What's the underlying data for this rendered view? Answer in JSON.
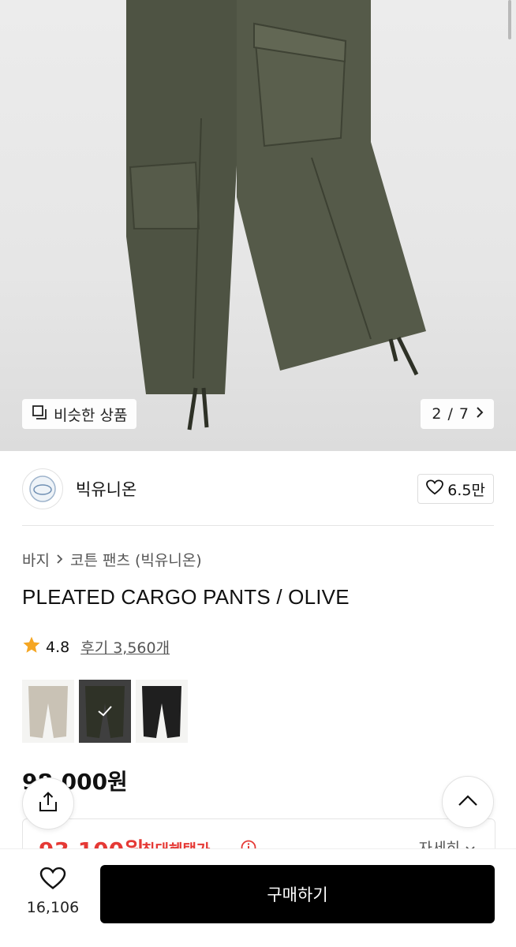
{
  "gallery": {
    "similar_label": "비슷한 상품",
    "page_current": "2",
    "page_separator": "/",
    "page_total": "7"
  },
  "brand": {
    "name": "빅유니온",
    "likes": "6.5만"
  },
  "breadcrumb": {
    "category": "바지",
    "sub_category": "코튼 팬츠 (빅유니온)"
  },
  "product": {
    "title": "PLEATED CARGO PANTS / OLIVE",
    "rating": "4.8",
    "reviews": "후기 3,560개",
    "price": "98,000원",
    "color_options": [
      {
        "color": "beige",
        "hex": "#c9c2b5",
        "selected": false
      },
      {
        "color": "olive",
        "hex": "#4e5343",
        "selected": true
      },
      {
        "color": "black",
        "hex": "#1f1f1f",
        "selected": false
      }
    ]
  },
  "benefit": {
    "price": "93,100원",
    "label": "최대혜택가",
    "detail": "자세히"
  },
  "bottom": {
    "wish_count": "16,106",
    "buy_label": "구매하기"
  },
  "colors": {
    "accent_red": "#e53935",
    "buy_button": "#000000",
    "product_olive": "#4e5343"
  },
  "icons": [
    "similar-icon",
    "chevron-right-icon",
    "heart-icon",
    "star-icon",
    "check-icon",
    "share-icon",
    "chevron-up-icon",
    "info-icon",
    "chevron-down-icon"
  ]
}
